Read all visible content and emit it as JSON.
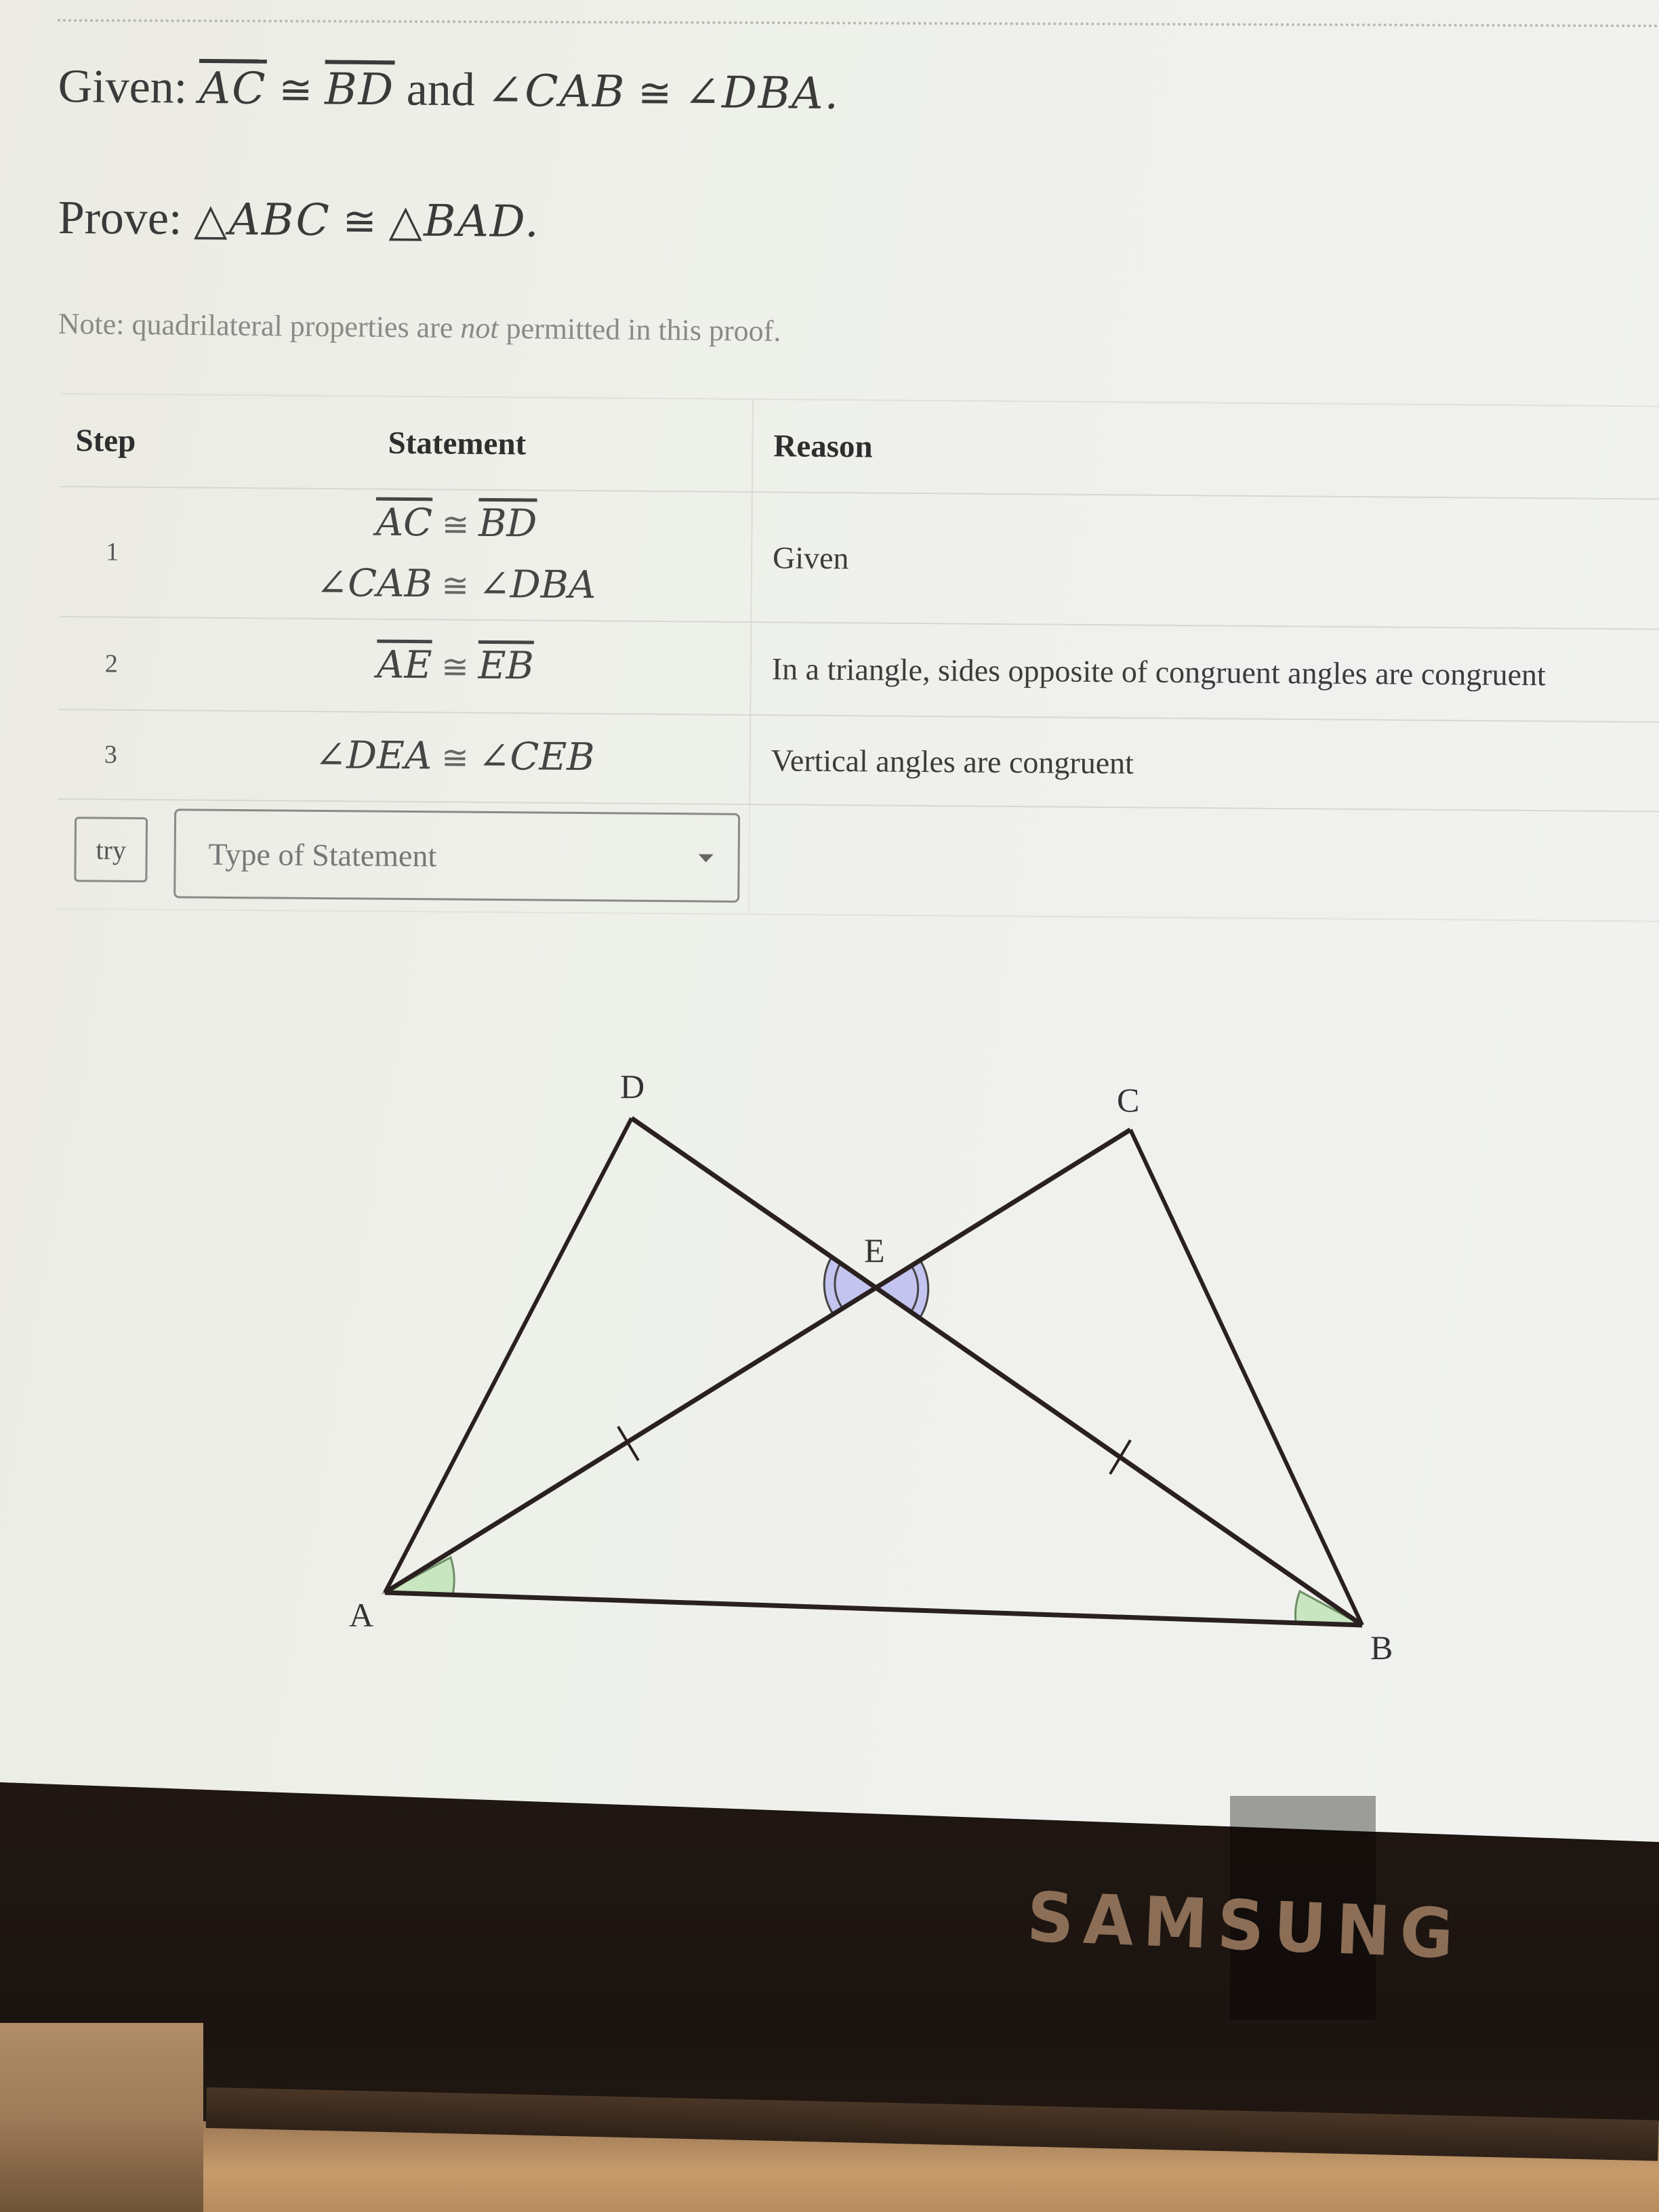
{
  "problem": {
    "given_label": "Given:",
    "given_seg1": "AC",
    "given_seg2": "BD",
    "given_and": "and",
    "given_angle1": "∠CAB",
    "given_angle2": "∠DBA.",
    "congruent_symbol": "≅",
    "prove_label": "Prove:",
    "prove_tri1": "△ABC",
    "prove_tri2": "△BAD.",
    "note_before": "Note: quadrilateral properties are ",
    "note_emph": "not",
    "note_after": " permitted in this proof."
  },
  "proof_table": {
    "headers": {
      "step": "Step",
      "statement": "Statement",
      "reason": "Reason"
    },
    "rows": [
      {
        "step": "1",
        "statements": [
          {
            "left": "AC",
            "right": "BD",
            "type": "segment"
          },
          {
            "left": "∠CAB",
            "right": "∠DBA",
            "type": "angle"
          }
        ],
        "reason": "Given"
      },
      {
        "step": "2",
        "statements": [
          {
            "left": "AE",
            "right": "EB",
            "type": "segment"
          }
        ],
        "reason": "In a triangle, sides opposite of congruent angles are congruent"
      },
      {
        "step": "3",
        "statements": [
          {
            "left": "∠DEA",
            "right": "∠CEB",
            "type": "angle"
          }
        ],
        "reason": "Vertical angles are congruent"
      }
    ],
    "try_button": "try",
    "statement_select": {
      "placeholder": "Type of Statement",
      "selected": ""
    }
  },
  "diagram": {
    "points": [
      "A",
      "B",
      "C",
      "D",
      "E"
    ],
    "segments": [
      "AD",
      "DB",
      "AC",
      "CB",
      "AB"
    ],
    "marks": {
      "equal_sides": [
        "AE",
        "EB"
      ],
      "equal_angles_green": [
        "∠CAB",
        "∠DBA"
      ],
      "equal_angles_purple_double_arc": [
        "∠DEA",
        "∠CEB"
      ]
    },
    "colors": {
      "angle_green": "#c8e6c0",
      "angle_purple": "#c4c4f0",
      "stroke": "#2a2020"
    }
  },
  "device": {
    "brand": "SAMSUNG"
  }
}
